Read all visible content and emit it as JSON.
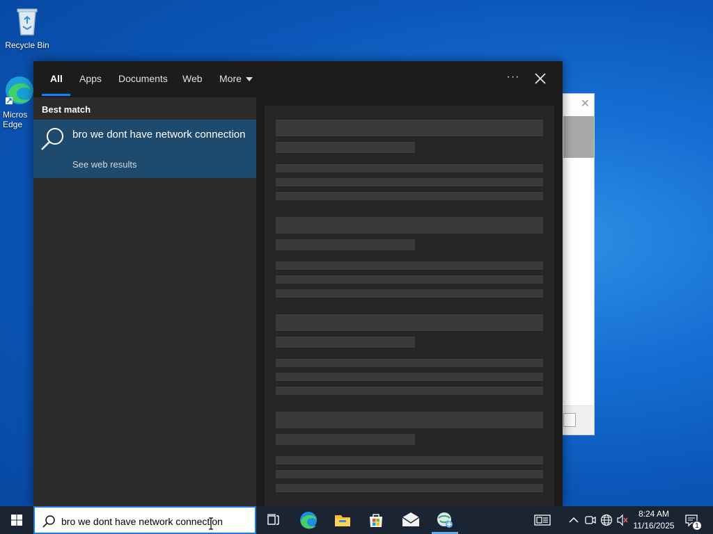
{
  "desktop": {
    "icons": [
      {
        "label": "Recycle Bin",
        "icon": "recycle-bin-icon"
      },
      {
        "label": "Micros\nEdge",
        "icon": "edge-icon"
      }
    ]
  },
  "search_panel": {
    "tabs": [
      {
        "label": "All",
        "active": true
      },
      {
        "label": "Apps"
      },
      {
        "label": "Documents"
      },
      {
        "label": "Web"
      },
      {
        "label": "More"
      }
    ],
    "ellipsis_label": "···",
    "best_match_label": "Best match",
    "result": {
      "title": "bro we dont have network connection",
      "subtitle": "See web results",
      "icon": "search-icon"
    }
  },
  "taskbar": {
    "search_value": "bro we dont have network connection",
    "pinned": [
      "task-view-icon",
      "edge-icon",
      "file-explorer-icon",
      "store-icon",
      "mail-icon",
      "network-app-icon"
    ],
    "clock_time": "8:24 AM",
    "clock_date": "11/16/2025",
    "notification_count": "1"
  },
  "colors": {
    "accent": "#0a84ff",
    "selection": "#1e4a6e",
    "taskbar": "#1a2433"
  }
}
